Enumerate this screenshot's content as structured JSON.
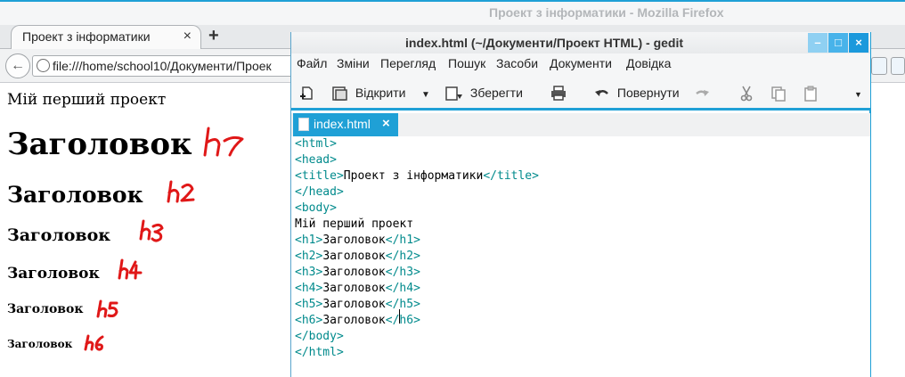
{
  "firefox": {
    "window_title": "Проект з інформатики - Mozilla Firefox",
    "tab_label": "Проект з інформатики",
    "tab_close": "×",
    "new_tab": "+",
    "url": "file:///home/school10/Документи/Проек",
    "content": {
      "body_text": "Мій перший проект",
      "headings": [
        "Заголовок",
        "Заголовок",
        "Заголовок",
        "Заголовок",
        "Заголовок",
        "Заголовок"
      ]
    },
    "handwritten_annotations": [
      "h1",
      "h2",
      "h3",
      "h4",
      "h5",
      "h6"
    ],
    "annotation_color": "#e01818"
  },
  "gedit": {
    "window_title": "index.html (~/Документи/Проект HTML) - gedit",
    "window_buttons": {
      "minimize": "–",
      "maximize": "□",
      "close": "×"
    },
    "menu": [
      "Файл",
      "Зміни",
      "Перегляд",
      "Пошук",
      "Засоби",
      "Документи",
      "Довідка"
    ],
    "toolbar": {
      "open_label": "Відкрити",
      "save_label": "Зберегти",
      "revert_label": "Повернути"
    },
    "tab_label": "index.html",
    "tab_close": "×",
    "code_lines": [
      "<html>",
      "<head>",
      "<title>Проект з інформатики</title>",
      "</head>",
      "<body>",
      "Мій перший проект",
      "<h1>Заголовок</h1>",
      "<h2>Заголовок</h2>",
      "<h3>Заголовок</h3>",
      "<h4>Заголовок</h4>",
      "<h5>Заголовок</h5>",
      "<h6>Заголовок</h6>",
      "</body>",
      "</html>"
    ],
    "accent_color": "#1fa0d6",
    "tag_color": "#008a8c"
  }
}
